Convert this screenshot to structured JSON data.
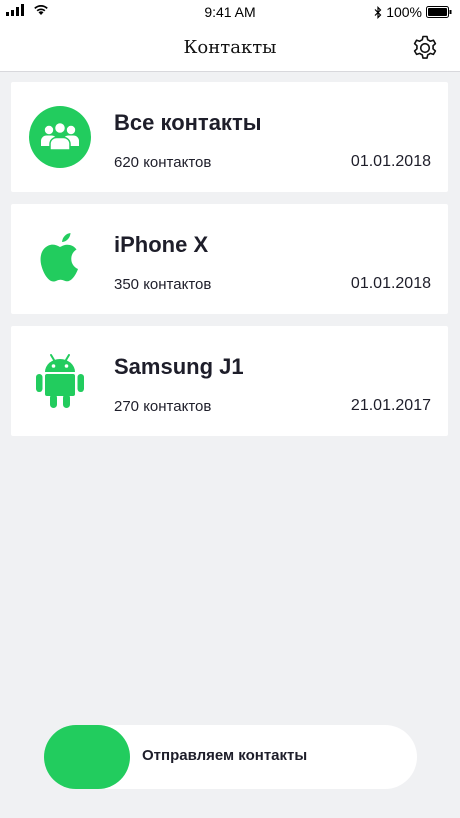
{
  "status_bar": {
    "time": "9:41 AM",
    "battery": "100%"
  },
  "nav": {
    "title": "Контакты"
  },
  "cards": [
    {
      "name": "Все контакты",
      "count": "620 контактов",
      "date": "01.01.2018",
      "icon": "contacts-group-icon"
    },
    {
      "name": "iPhone X",
      "count": "350 контактов",
      "date": "01.01.2018",
      "icon": "apple-icon"
    },
    {
      "name": "Samsung J1",
      "count": "270 контактов",
      "date": "21.01.2017",
      "icon": "android-icon"
    }
  ],
  "send": {
    "label": "Отправляем контакты",
    "progress": 0.23
  },
  "colors": {
    "accent": "#22cc5e",
    "background": "#f0f1f3",
    "text": "#1e1e2a"
  }
}
